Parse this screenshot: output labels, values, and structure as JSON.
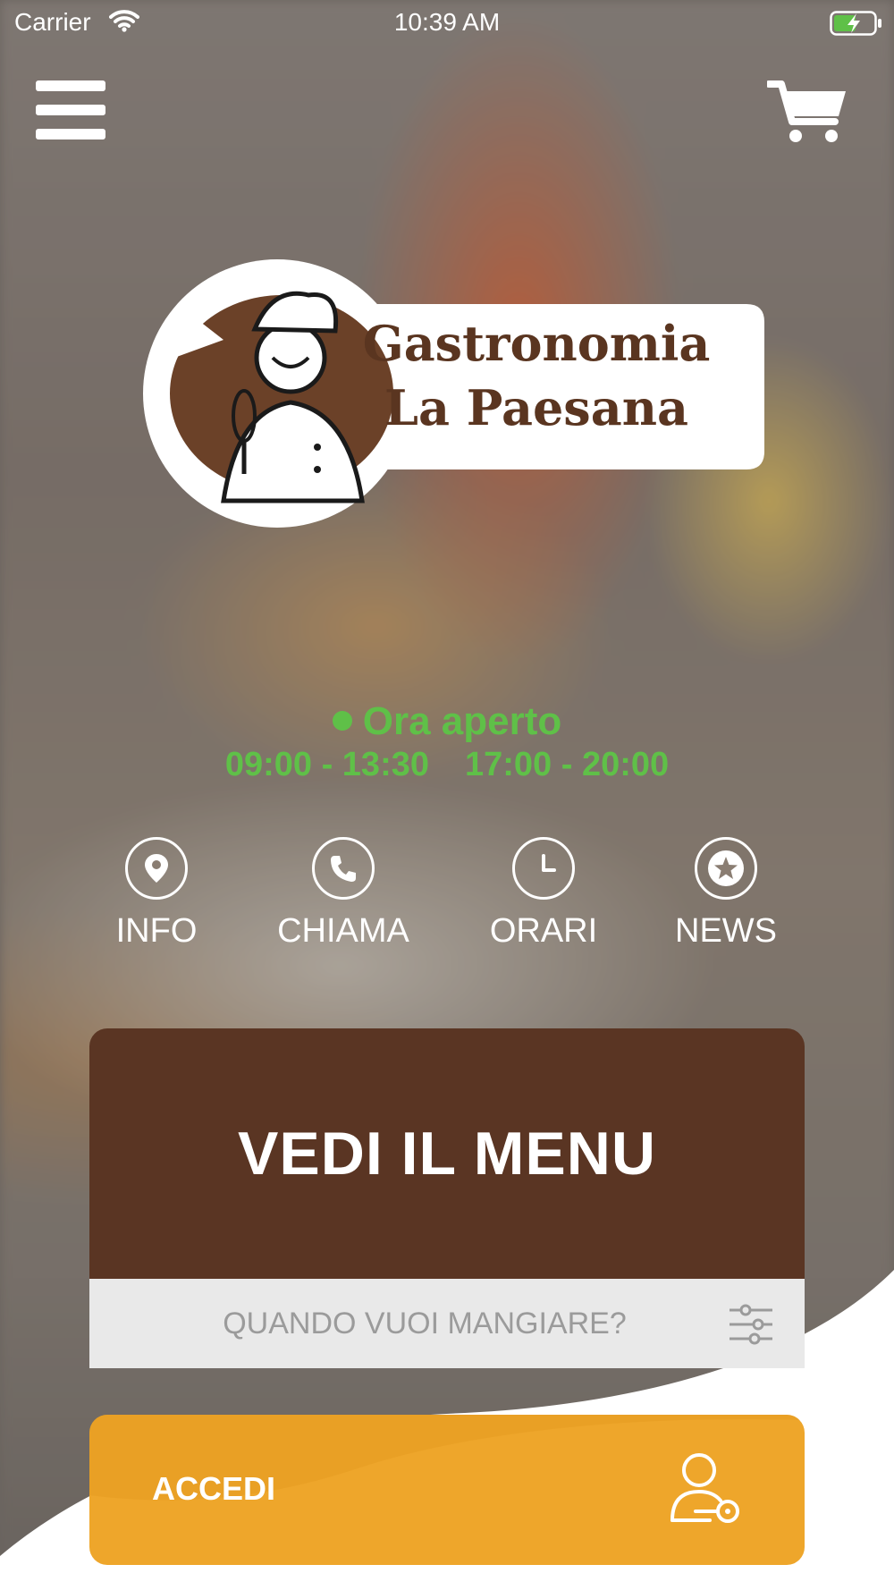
{
  "status_bar": {
    "carrier": "Carrier",
    "time": "10:39 AM"
  },
  "logo": {
    "line1": "Gastronomia",
    "line2": "La Paesana"
  },
  "status": {
    "open_text": "Ora aperto",
    "hours_morning": "09:00 - 13:30",
    "hours_evening": "17:00 - 20:00",
    "color": "#5fc048"
  },
  "actions": [
    {
      "label": "INFO",
      "icon": "location-pin-icon"
    },
    {
      "label": "CHIAMA",
      "icon": "phone-icon"
    },
    {
      "label": "ORARI",
      "icon": "clock-icon"
    },
    {
      "label": "NEWS",
      "icon": "star-bubble-icon"
    }
  ],
  "menu_card": {
    "title": "VEDI IL MENU",
    "color": "#5a3523"
  },
  "when": {
    "placeholder": "QUANDO VUOI MANGIARE?"
  },
  "login": {
    "label": "ACCEDI",
    "color": "#eea62b"
  }
}
